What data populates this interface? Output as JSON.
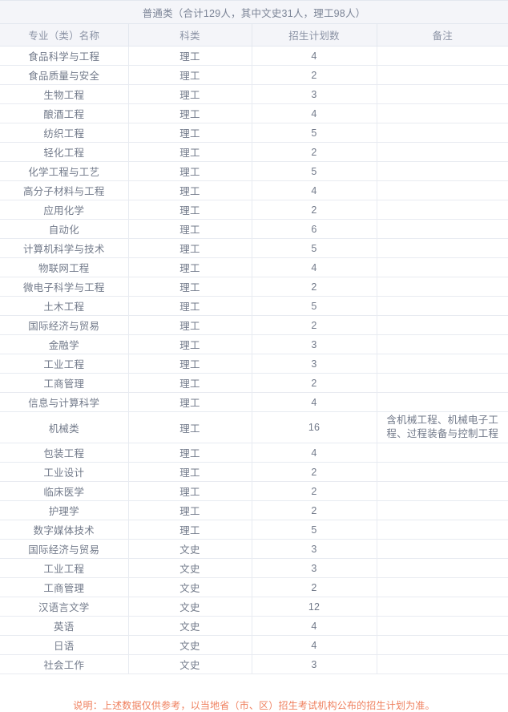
{
  "table": {
    "title": "普通类（合计129人，其中文史31人，理工98人）",
    "columns": [
      "专业（类）名称",
      "科类",
      "招生计划数",
      "备注"
    ],
    "rows": [
      {
        "major": "食品科学与工程",
        "category": "理工",
        "count": "4",
        "remark": ""
      },
      {
        "major": "食品质量与安全",
        "category": "理工",
        "count": "2",
        "remark": ""
      },
      {
        "major": "生物工程",
        "category": "理工",
        "count": "3",
        "remark": ""
      },
      {
        "major": "酿酒工程",
        "category": "理工",
        "count": "4",
        "remark": ""
      },
      {
        "major": "纺织工程",
        "category": "理工",
        "count": "5",
        "remark": ""
      },
      {
        "major": "轻化工程",
        "category": "理工",
        "count": "2",
        "remark": ""
      },
      {
        "major": "化学工程与工艺",
        "category": "理工",
        "count": "5",
        "remark": ""
      },
      {
        "major": "高分子材料与工程",
        "category": "理工",
        "count": "4",
        "remark": ""
      },
      {
        "major": "应用化学",
        "category": "理工",
        "count": "2",
        "remark": ""
      },
      {
        "major": "自动化",
        "category": "理工",
        "count": "6",
        "remark": ""
      },
      {
        "major": "计算机科学与技术",
        "category": "理工",
        "count": "5",
        "remark": ""
      },
      {
        "major": "物联网工程",
        "category": "理工",
        "count": "4",
        "remark": ""
      },
      {
        "major": "微电子科学与工程",
        "category": "理工",
        "count": "2",
        "remark": ""
      },
      {
        "major": "土木工程",
        "category": "理工",
        "count": "5",
        "remark": ""
      },
      {
        "major": "国际经济与贸易",
        "category": "理工",
        "count": "2",
        "remark": ""
      },
      {
        "major": "金融学",
        "category": "理工",
        "count": "3",
        "remark": ""
      },
      {
        "major": "工业工程",
        "category": "理工",
        "count": "3",
        "remark": ""
      },
      {
        "major": "工商管理",
        "category": "理工",
        "count": "2",
        "remark": ""
      },
      {
        "major": "信息与计算科学",
        "category": "理工",
        "count": "4",
        "remark": ""
      },
      {
        "major": "机械类",
        "category": "理工",
        "count": "16",
        "remark": "含机械工程、机械电子工程、过程装备与控制工程",
        "tall": true
      },
      {
        "major": "包装工程",
        "category": "理工",
        "count": "4",
        "remark": ""
      },
      {
        "major": "工业设计",
        "category": "理工",
        "count": "2",
        "remark": ""
      },
      {
        "major": "临床医学",
        "category": "理工",
        "count": "2",
        "remark": ""
      },
      {
        "major": "护理学",
        "category": "理工",
        "count": "2",
        "remark": ""
      },
      {
        "major": "数字媒体技术",
        "category": "理工",
        "count": "5",
        "remark": ""
      },
      {
        "major": "国际经济与贸易",
        "category": "文史",
        "count": "3",
        "remark": ""
      },
      {
        "major": "工业工程",
        "category": "文史",
        "count": "3",
        "remark": ""
      },
      {
        "major": "工商管理",
        "category": "文史",
        "count": "2",
        "remark": ""
      },
      {
        "major": "汉语言文学",
        "category": "文史",
        "count": "12",
        "remark": ""
      },
      {
        "major": "英语",
        "category": "文史",
        "count": "4",
        "remark": ""
      },
      {
        "major": "日语",
        "category": "文史",
        "count": "4",
        "remark": ""
      },
      {
        "major": "社会工作",
        "category": "文史",
        "count": "3",
        "remark": ""
      }
    ]
  },
  "footnote": "说明：上述数据仅供参考，以当地省（市、区）招生考试机构公布的招生计划为准。",
  "colors": {
    "header_bg": "#f4f5f9",
    "border": "#e8ebf1",
    "text": "#727a8a",
    "footnote": "#ef7f5d"
  }
}
